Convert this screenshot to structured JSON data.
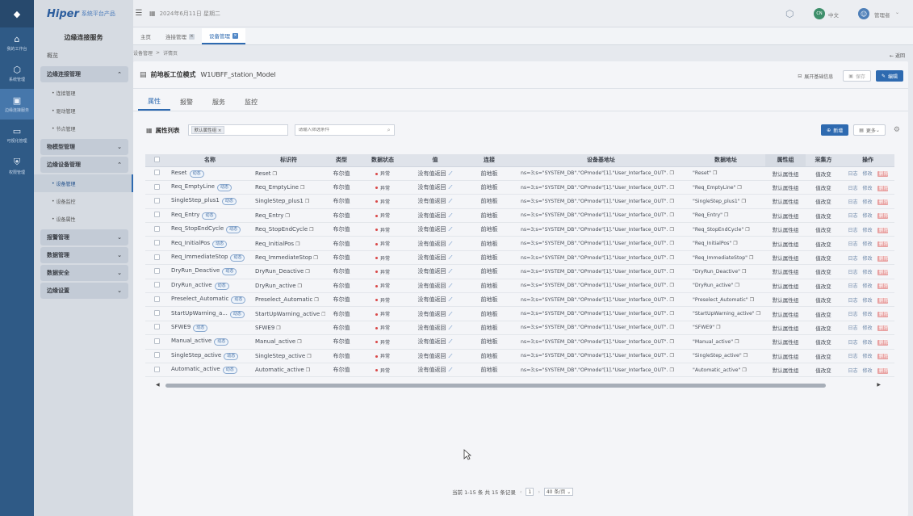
{
  "header": {
    "brand": "Hiper",
    "brand_sub": "系统平台产品",
    "date": "2024年6月11日 星期二",
    "lang": "中文",
    "user": "管理者",
    "lang_avatar": "CN"
  },
  "iconbar": {
    "items": [
      {
        "icon": "home-icon",
        "label": "我的工作台"
      },
      {
        "icon": "cube-icon",
        "label": "系统管理"
      },
      {
        "icon": "device-icon",
        "label": "边缘连接服务"
      },
      {
        "icon": "monitor-icon",
        "label": "可视化管理"
      },
      {
        "icon": "shield-icon",
        "label": "权限管理"
      }
    ]
  },
  "sidebar": {
    "title": "边缘连接服务",
    "overview": "概览",
    "groups": [
      {
        "label": "边缘连接管理",
        "expanded": true,
        "items": [
          "连接管理",
          "驱动管理",
          "节点管理"
        ]
      },
      {
        "label": "物模型管理",
        "expanded": false,
        "items": []
      },
      {
        "label": "边缘设备管理",
        "expanded": true,
        "items": [
          "设备管理",
          "设备监控",
          "设备属性"
        ]
      },
      {
        "label": "报警管理",
        "expanded": false,
        "items": []
      },
      {
        "label": "数据管理",
        "expanded": false,
        "items": []
      },
      {
        "label": "数据安全",
        "expanded": false,
        "items": []
      },
      {
        "label": "边缘设置",
        "expanded": false,
        "items": []
      }
    ]
  },
  "tabs": [
    {
      "label": "主页",
      "closable": false,
      "active": false
    },
    {
      "label": "连接管理",
      "closable": true,
      "active": false
    },
    {
      "label": "设备管理",
      "closable": true,
      "active": true
    }
  ],
  "breadcrumb": {
    "parent": "设备管理",
    "sep": ">",
    "current": "详情页"
  },
  "back_label": "返回",
  "device": {
    "name": "前地板工位模式",
    "model": "W1UBFF_station_Model",
    "actions": {
      "expand": "展开基础信息",
      "save": "保存",
      "edit": "编辑"
    }
  },
  "subtabs": [
    "属性",
    "报警",
    "服务",
    "监控"
  ],
  "toolbar": {
    "list_title": "属性列表",
    "filter_tag": "默认属性组",
    "search_placeholder": "请输入筛选条件",
    "new_label": "新增",
    "more_label": "更多"
  },
  "table": {
    "columns": [
      "名称",
      "标识符",
      "类型",
      "数据状态",
      "值",
      "连接",
      "设备基地址",
      "数据地址",
      "属性组",
      "采集方",
      "操作"
    ],
    "tag_label": "动态",
    "type_value": "布尔值",
    "status_value": "异常",
    "value_text": "没有值返回",
    "conn_value": "前地板",
    "group_value": "默认属性组",
    "collect_value": "值改变",
    "op_log": "日志",
    "op_edit": "修改",
    "op_delete": "删除",
    "rows": [
      {
        "name": "Reset",
        "id": "Reset",
        "addr": "ns=3;s=\"SYSTEM_DB\".\"OPmode\"[1].\"User_Interface_OUT\".",
        "data": "\"Reset\""
      },
      {
        "name": "Req_EmptyLine",
        "id": "Req_EmptyLine",
        "addr": "ns=3;s=\"SYSTEM_DB\".\"OPmode\"[1].\"User_Interface_OUT\".",
        "data": "\"Req_EmptyLine\""
      },
      {
        "name": "SingleStep_plus1",
        "id": "SingleStep_plus1",
        "addr": "ns=3;s=\"SYSTEM_DB\".\"OPmode\"[1].\"User_Interface_OUT\".",
        "data": "\"SingleStep_plus1\""
      },
      {
        "name": "Req_Entry",
        "id": "Req_Entry",
        "addr": "ns=3;s=\"SYSTEM_DB\".\"OPmode\"[1].\"User_Interface_OUT\".",
        "data": "\"Req_Entry\""
      },
      {
        "name": "Req_StopEndCycle",
        "id": "Req_StopEndCycle",
        "addr": "ns=3;s=\"SYSTEM_DB\".\"OPmode\"[1].\"User_Interface_OUT\".",
        "data": "\"Req_StopEndCycle\""
      },
      {
        "name": "Req_InitialPos",
        "id": "Req_InitialPos",
        "addr": "ns=3;s=\"SYSTEM_DB\".\"OPmode\"[1].\"User_Interface_OUT\".",
        "data": "\"Req_InitialPos\""
      },
      {
        "name": "Req_ImmediateStop",
        "id": "Req_ImmediateStop",
        "addr": "ns=3;s=\"SYSTEM_DB\".\"OPmode\"[1].\"User_Interface_OUT\".",
        "data": "\"Req_ImmediateStop\""
      },
      {
        "name": "DryRun_Deactive",
        "id": "DryRun_Deactive",
        "addr": "ns=3;s=\"SYSTEM_DB\".\"OPmode\"[1].\"User_Interface_OUT\".",
        "data": "\"DryRun_Deactive\""
      },
      {
        "name": "DryRun_active",
        "id": "DryRun_active",
        "addr": "ns=3;s=\"SYSTEM_DB\".\"OPmode\"[1].\"User_Interface_OUT\".",
        "data": "\"DryRun_active\""
      },
      {
        "name": "Preselect_Automatic",
        "id": "Preselect_Automatic",
        "addr": "ns=3;s=\"SYSTEM_DB\".\"OPmode\"[1].\"User_Interface_OUT\".",
        "data": "\"Preselect_Automatic\""
      },
      {
        "name": "StartUpWarning_a...",
        "id": "StartUpWarning_active",
        "addr": "ns=3;s=\"SYSTEM_DB\".\"OPmode\"[1].\"User_Interface_OUT\".",
        "data": "\"StartUpWarning_active\""
      },
      {
        "name": "SFWE9",
        "id": "SFWE9",
        "addr": "ns=3;s=\"SYSTEM_DB\".\"OPmode\"[1].\"User_Interface_OUT\".",
        "data": "\"SFWE9\""
      },
      {
        "name": "Manual_active",
        "id": "Manual_active",
        "addr": "ns=3;s=\"SYSTEM_DB\".\"OPmode\"[1].\"User_Interface_OUT\".",
        "data": "\"Manual_active\""
      },
      {
        "name": "SingleStep_active",
        "id": "SingleStep_active",
        "addr": "ns=3;s=\"SYSTEM_DB\".\"OPmode\"[1].\"User_Interface_OUT\".",
        "data": "\"SingleStep_active\""
      },
      {
        "name": "Automatic_active",
        "id": "Automatic_active",
        "addr": "ns=3;s=\"SYSTEM_DB\".\"OPmode\"[1].\"User_Interface_OUT\".",
        "data": "\"Automatic_active\""
      }
    ]
  },
  "pagination": {
    "summary": "当前 1-15 条 共 15 条记录",
    "page": "1",
    "page_size": "40 条/页"
  },
  "colors": {
    "primary": "#2e6ab0",
    "sidebar": "#2f5a86",
    "danger": "#d94848"
  }
}
